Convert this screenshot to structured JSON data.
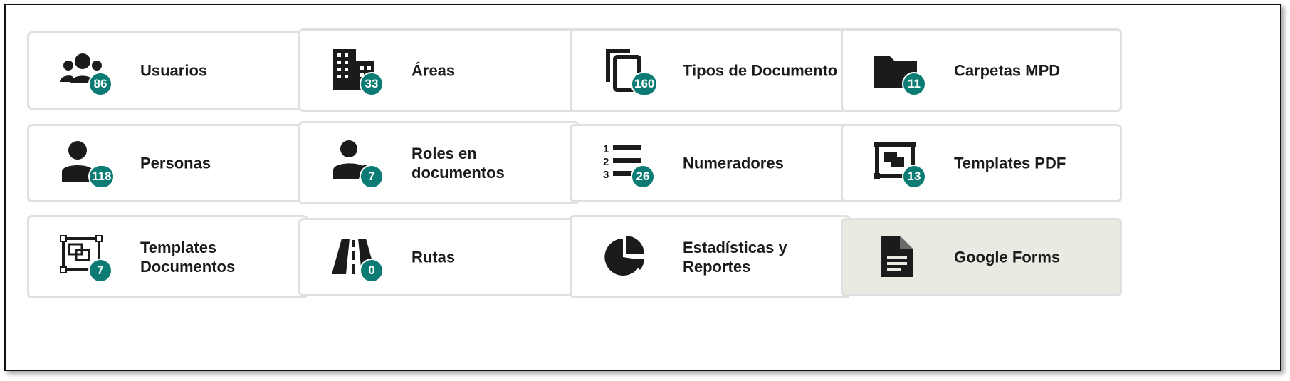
{
  "cards": [
    {
      "label": "Usuarios",
      "count": "86",
      "icon": "users-icon"
    },
    {
      "label": "Áreas",
      "count": "33",
      "icon": "building-icon"
    },
    {
      "label": "Tipos de Documento",
      "count": "160",
      "icon": "copy-documents-icon"
    },
    {
      "label": "Carpetas MPD",
      "count": "11",
      "icon": "folder-icon"
    },
    {
      "label": "Personas",
      "count": "118",
      "icon": "person-icon"
    },
    {
      "label": "Roles en documentos",
      "count": "7",
      "icon": "person-tag-icon"
    },
    {
      "label": "Numeradores",
      "count": "26",
      "icon": "numbered-list-icon"
    },
    {
      "label": "Templates PDF",
      "count": "13",
      "icon": "template-frame-icon"
    },
    {
      "label": "Templates Documentos",
      "count": "7",
      "icon": "template-frame-outline-icon"
    },
    {
      "label": "Rutas",
      "count": "0",
      "icon": "road-icon"
    },
    {
      "label": "Estadísticas y Reportes",
      "count": "",
      "icon": "pie-chart-icon"
    },
    {
      "label": "Google Forms",
      "count": "",
      "icon": "document-icon"
    }
  ],
  "colors": {
    "badge": "#0c7b74",
    "highlight": "#ebeae2",
    "border": "#e0e0e0",
    "icon": "#1b1b1b"
  }
}
